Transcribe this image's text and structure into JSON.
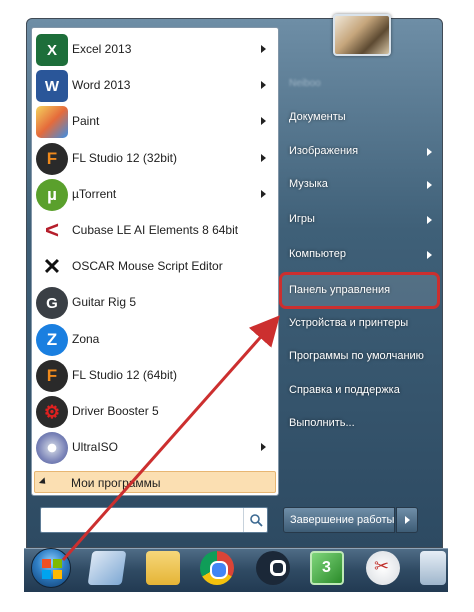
{
  "programs": [
    {
      "label": "Excel 2013",
      "icon": "excel-icon",
      "icon_glyph": "X",
      "has_arrow": true
    },
    {
      "label": "Word 2013",
      "icon": "word-icon",
      "icon_glyph": "W",
      "has_arrow": true
    },
    {
      "label": "Paint",
      "icon": "paint-icon",
      "icon_glyph": "",
      "has_arrow": true
    },
    {
      "label": "FL Studio 12 (32bit)",
      "icon": "fl-studio-icon",
      "icon_glyph": "F",
      "has_arrow": true
    },
    {
      "label": "µTorrent",
      "icon": "utorrent-icon",
      "icon_glyph": "µ",
      "has_arrow": true
    },
    {
      "label": "Cubase LE AI Elements 8 64bit",
      "icon": "cubase-icon",
      "icon_glyph": "<",
      "has_arrow": false
    },
    {
      "label": "OSCAR Mouse Script Editor",
      "icon": "oscar-icon",
      "icon_glyph": "✕",
      "has_arrow": false
    },
    {
      "label": "Guitar Rig 5",
      "icon": "guitar-rig-icon",
      "icon_glyph": "G",
      "has_arrow": false
    },
    {
      "label": "Zona",
      "icon": "zona-icon",
      "icon_glyph": "Z",
      "has_arrow": false
    },
    {
      "label": "FL Studio 12 (64bit)",
      "icon": "fl-studio-icon",
      "icon_glyph": "F",
      "has_arrow": false
    },
    {
      "label": "Driver Booster 5",
      "icon": "driver-booster-icon",
      "icon_glyph": "⚙",
      "has_arrow": false
    },
    {
      "label": "UltraISO",
      "icon": "ultraiso-icon",
      "icon_glyph": "",
      "has_arrow": true
    }
  ],
  "all_programs_label": "Мои программы",
  "search": {
    "placeholder": "",
    "value": "",
    "icon": "search-icon"
  },
  "user": {
    "name": "Neiboo",
    "picture_icon": "user-tiger-icon"
  },
  "right_items": [
    {
      "label": "Документы",
      "has_arrow": false
    },
    {
      "label": "Изображения",
      "has_arrow": true
    },
    {
      "label": "Музыка",
      "has_arrow": true
    },
    {
      "label": "Игры",
      "has_arrow": true
    },
    {
      "label": "Компьютер",
      "has_arrow": true
    },
    {
      "label": "Панель управления",
      "has_arrow": false
    },
    {
      "label": "Устройства и принтеры",
      "has_arrow": false
    },
    {
      "label": "Программы по умолчанию",
      "has_arrow": false
    },
    {
      "label": "Справка и поддержка",
      "has_arrow": false
    },
    {
      "label": "Выполнить...",
      "has_arrow": false
    }
  ],
  "shutdown_label": "Завершение работы",
  "taskbar": {
    "start_icon": "windows-start-orb-icon",
    "pinned": [
      "notepad-icon",
      "explorer-icon",
      "chrome-icon",
      "steam-icon",
      "media-player-icon",
      "snipping-tool-icon",
      "calculator-icon"
    ]
  },
  "colors": {
    "highlight": "#cc2f2f",
    "arrow": "#cc2f2f",
    "all_programs_bg": "#fbdfb2"
  }
}
